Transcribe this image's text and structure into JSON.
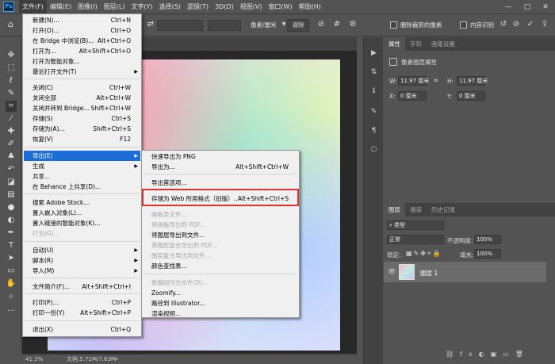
{
  "menubar": {
    "logo": "Ps",
    "items": [
      "文件(F)",
      "编辑(E)",
      "图像(I)",
      "图层(L)",
      "文字(Y)",
      "选择(S)",
      "滤镜(T)",
      "3D(D)",
      "视图(V)",
      "窗口(W)",
      "帮助(H)"
    ],
    "window_controls": [
      "—",
      "□",
      "✕"
    ]
  },
  "options": {
    "unit_select": "像素/厘米",
    "clear_button": "清除",
    "delete_cropped_label": "删除裁剪的像素",
    "content_aware_label": "内容识别"
  },
  "file_menu": {
    "items": [
      {
        "label": "新建(N)...",
        "shortcut": "Ctrl+N"
      },
      {
        "label": "打开(O)...",
        "shortcut": "Ctrl+O"
      },
      {
        "label": "在 Bridge 中浏览(B)...",
        "shortcut": "Alt+Ctrl+O"
      },
      {
        "label": "打开为...",
        "shortcut": "Alt+Shift+Ctrl+O"
      },
      {
        "label": "打开为智能对象...",
        "shortcut": ""
      },
      {
        "label": "最近打开文件(T)",
        "shortcut": ""
      },
      {
        "label": "关闭(C)",
        "shortcut": "Ctrl+W"
      },
      {
        "label": "关闭全部",
        "shortcut": "Alt+Ctrl+W"
      },
      {
        "label": "关闭并转到 Bridge...",
        "shortcut": "Shift+Ctrl+W"
      },
      {
        "label": "存储(S)",
        "shortcut": "Ctrl+S"
      },
      {
        "label": "存储为(A)...",
        "shortcut": "Shift+Ctrl+S"
      },
      {
        "label": "恢复(V)",
        "shortcut": "F12"
      },
      {
        "label": "导出(E)",
        "shortcut": ""
      },
      {
        "label": "生成",
        "shortcut": ""
      },
      {
        "label": "共享...",
        "shortcut": ""
      },
      {
        "label": "在 Behance 上共享(D)...",
        "shortcut": ""
      },
      {
        "label": "搜索 Adobe Stock...",
        "shortcut": ""
      },
      {
        "label": "置入嵌入对象(L)...",
        "shortcut": ""
      },
      {
        "label": "置入链接的智能对象(K)...",
        "shortcut": ""
      },
      {
        "label": "打包(G)...",
        "shortcut": ""
      },
      {
        "label": "自动(U)",
        "shortcut": ""
      },
      {
        "label": "脚本(R)",
        "shortcut": ""
      },
      {
        "label": "导入(M)",
        "shortcut": ""
      },
      {
        "label": "文件简介(F)...",
        "shortcut": "Alt+Shift+Ctrl+I"
      },
      {
        "label": "打印(P)...",
        "shortcut": "Ctrl+P"
      },
      {
        "label": "打印一份(Y)",
        "shortcut": "Alt+Shift+Ctrl+P"
      },
      {
        "label": "退出(X)",
        "shortcut": "Ctrl+Q"
      }
    ]
  },
  "export_menu": {
    "items": [
      {
        "label": "快速导出为 PNG",
        "shortcut": ""
      },
      {
        "label": "导出为...",
        "shortcut": "Alt+Shift+Ctrl+W"
      },
      {
        "label": "导出首选项...",
        "shortcut": ""
      },
      {
        "label": "存储为 Web 所用格式（旧版）...",
        "shortcut": "Alt+Shift+Ctrl+S"
      },
      {
        "label": "画板至文件...",
        "shortcut": ""
      },
      {
        "label": "将画板导出到 PDF...",
        "shortcut": ""
      },
      {
        "label": "将图层导出到文件...",
        "shortcut": ""
      },
      {
        "label": "将图层复合导出到 PDF...",
        "shortcut": ""
      },
      {
        "label": "图层复合导出到文件...",
        "shortcut": ""
      },
      {
        "label": "颜色查找表...",
        "shortcut": ""
      },
      {
        "label": "数据组作为文件(D)...",
        "shortcut": ""
      },
      {
        "label": "Zoomify...",
        "shortcut": ""
      },
      {
        "label": "路径到 Illustrator...",
        "shortcut": ""
      },
      {
        "label": "渲染视频...",
        "shortcut": ""
      }
    ]
  },
  "properties_panel": {
    "tabs": [
      "属性",
      "字符",
      "画笔设置"
    ],
    "title": "像素图层属性",
    "w_label": "W:",
    "w_value": "11.97 厘米",
    "h_label": "H:",
    "h_value": "11.97 厘米",
    "x_label": "X:",
    "x_value": "0 厘米",
    "y_label": "Y:",
    "y_value": "0 厘米",
    "link_icon": "∞"
  },
  "layers_panel": {
    "tabs": [
      "图层",
      "通道",
      "历史记录"
    ],
    "filter_label": "类型",
    "blend_mode": "正常",
    "opacity_label": "不透明度:",
    "opacity_value": "100%",
    "lock_label": "锁定:",
    "fill_label": "填充:",
    "fill_value": "100%",
    "layer_name": "图层 1"
  },
  "status": {
    "zoom": "41.3%",
    "doc_info": "文档:5.72M/7.63M"
  },
  "colors": {
    "accent": "#1c6ed6",
    "highlight_border": "#e03030",
    "foreground": "#ff0000",
    "background": "#ffffff"
  }
}
